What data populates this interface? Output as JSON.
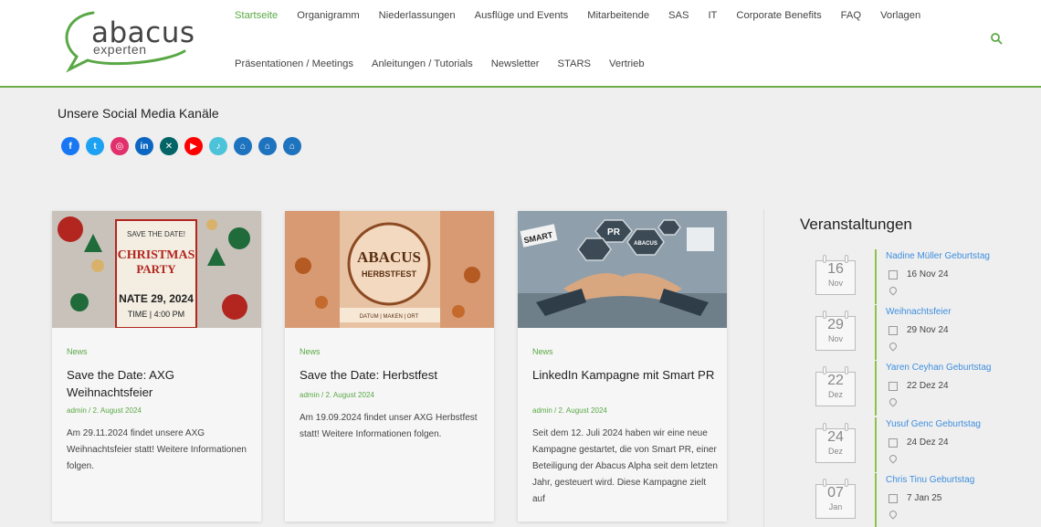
{
  "header": {
    "logo": {
      "main": "abacus",
      "sub": "experten"
    },
    "nav_row1": [
      "Startseite",
      "Organigramm",
      "Niederlassungen",
      "Ausflüge und Events",
      "Mitarbeitende",
      "SAS",
      "IT",
      "Corporate Benefits",
      "FAQ",
      "Vorlagen"
    ],
    "nav_row2": [
      "Präsentationen / Meetings",
      "Anleitungen / Tutorials",
      "Newsletter",
      "STARS",
      "Vertrieb"
    ],
    "active_nav": "Startseite"
  },
  "social": {
    "title": "Unsere Social Media Kanäle",
    "icons": [
      {
        "name": "facebook-icon",
        "glyph": "f",
        "color": "#1877f2"
      },
      {
        "name": "twitter-icon",
        "glyph": "t",
        "color": "#1da1f2"
      },
      {
        "name": "instagram-icon",
        "glyph": "◎",
        "color": "#e1306c"
      },
      {
        "name": "linkedin-icon",
        "glyph": "in",
        "color": "#0a66c2"
      },
      {
        "name": "xing-icon",
        "glyph": "✕",
        "color": "#026466"
      },
      {
        "name": "youtube-icon",
        "glyph": "▶",
        "color": "#ff0000"
      },
      {
        "name": "tiktok-icon",
        "glyph": "♪",
        "color": "#4cc3d9"
      },
      {
        "name": "home-icon",
        "glyph": "⌂",
        "color": "#1e73be"
      },
      {
        "name": "home-icon",
        "glyph": "⌂",
        "color": "#1e73be"
      },
      {
        "name": "home-icon",
        "glyph": "⌂",
        "color": "#1e73be"
      }
    ]
  },
  "posts": [
    {
      "category": "News",
      "title": "Save the Date: AXG Weihnachtsfeier",
      "meta": "admin / 2. August 2024",
      "text": "Am 29.11.2024 findet unsere AXG Weihnachtsfeier statt! Weitere Informationen folgen.",
      "image_label": "CHRISTMAS PARTY"
    },
    {
      "category": "News",
      "title": "Save the Date: Herbstfest",
      "meta": "admin / 2. August 2024",
      "text": "Am 19.09.2024 findet unser AXG Herbstfest statt! Weitere Informationen folgen.",
      "image_label": "ABACUS HERBSTFEST"
    },
    {
      "category": "News",
      "title": "LinkedIn Kampagne mit Smart PR",
      "meta": "admin / 2. August 2024",
      "text": "Seit dem 12. Juli 2024 haben wir eine neue Kampagne gestartet, die von Smart PR, einer Beteiligung der Abacus Alpha seit dem letzten Jahr, gesteuert wird. Diese Kampagne zielt auf",
      "image_label": "SMART PR"
    }
  ],
  "events": {
    "title": "Veranstaltungen",
    "items": [
      {
        "day": "16",
        "month": "Nov",
        "name": "Nadine Müller Geburtstag",
        "date": "16 Nov 24"
      },
      {
        "day": "29",
        "month": "Nov",
        "name": "Weihnachtsfeier",
        "date": "29 Nov 24"
      },
      {
        "day": "22",
        "month": "Dez",
        "name": "Yaren Ceyhan Geburtstag",
        "date": "22 Dez 24"
      },
      {
        "day": "24",
        "month": "Dez",
        "name": "Yusuf Genc Geburtstag",
        "date": "24 Dez 24"
      },
      {
        "day": "07",
        "month": "Jan",
        "name": "Chris Tinu Geburtstag",
        "date": "7 Jan 25"
      }
    ]
  },
  "colors": {
    "accent": "#5aa845",
    "link": "#3e8ede"
  }
}
